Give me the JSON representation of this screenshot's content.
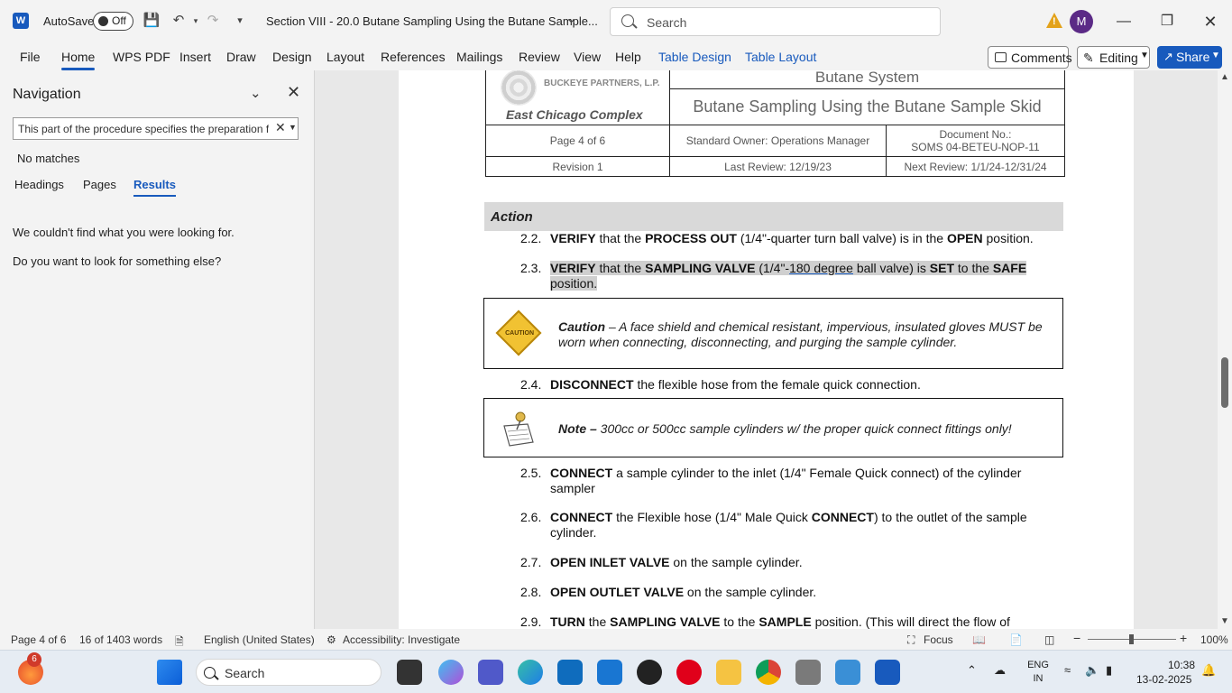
{
  "titlebar": {
    "autosave_label": "AutoSave",
    "autosave_state": "Off",
    "doc_title": "Section VIII - 20.0 Butane Sampling Using the Butane Sample...",
    "search_placeholder": "Search",
    "avatar_initial": "M"
  },
  "ribbon": {
    "tabs": [
      "File",
      "Home",
      "WPS PDF",
      "Insert",
      "Draw",
      "Design",
      "Layout",
      "References",
      "Mailings",
      "Review",
      "View",
      "Help",
      "Table Design",
      "Table Layout"
    ],
    "comments_label": "Comments",
    "editing_label": "Editing",
    "share_label": "Share"
  },
  "nav": {
    "title": "Navigation",
    "search_value": "This part of the procedure specifies the preparation f",
    "no_matches": "No matches",
    "tabs": [
      "Headings",
      "Pages",
      "Results"
    ],
    "message1": "We couldn't find what you were looking for.",
    "message2": "Do you want to look for something else?"
  },
  "doc": {
    "header": {
      "company": "BUCKEYE PARTNERS, L.P.",
      "site": "East Chicago Complex",
      "system": "Butane System",
      "procedure": "Butane Sampling Using the Butane Sample Skid",
      "page": "Page 4 of 6",
      "owner": "Standard Owner: Operations Manager",
      "docno_label": "Document No.:",
      "docno": "SOMS 04-BETEU-NOP-11",
      "revision": "Revision 1",
      "last_review": "Last Review: 12/19/23",
      "next_review": "Next Review: 1/1/24-12/31/24"
    },
    "action_label": "Action",
    "steps": {
      "s22": {
        "num": "2.2.",
        "b1": "VERIFY",
        "t1": " that the ",
        "b2": "PROCESS OUT",
        "t2": " (1/4\"-quarter turn ball valve) is in the ",
        "b3": "OPEN",
        "t3": " position."
      },
      "s23": {
        "num": "2.3.",
        "b1": "VERIFY",
        "t1": " that the ",
        "b2": "SAMPLING VALVE",
        "t2": " (1/4\"-",
        "u1": "180 degree",
        "t3": " ball valve) is ",
        "b3": "SET",
        "t4": " to the ",
        "b4": "SAFE",
        "t5": " position."
      },
      "caution_sign": "CAUTION",
      "caution_bold": "Caution",
      "caution_text": " – A face shield and chemical resistant, impervious, insulated gloves MUST be worn when connecting, disconnecting, and purging the sample cylinder.",
      "s24": {
        "num": "2.4.",
        "b1": "DISCONNECT",
        "t1": " the flexible hose from the female quick connection."
      },
      "note_bold": "Note –",
      "note_text": " 300cc or 500cc sample cylinders w/ the proper quick connect fittings only!",
      "s25": {
        "num": "2.5.",
        "b1": "CONNECT",
        "t1": " a sample cylinder to the inlet (1/4\" Female Quick connect) of the cylinder sampler"
      },
      "s26": {
        "num": "2.6.",
        "b1": "CONNECT",
        "t1": " the Flexible hose (1/4\" Male Quick ",
        "b2": "CONNECT",
        "t2": ") to the outlet of the sample cylinder."
      },
      "s27": {
        "num": "2.7.",
        "b1": "OPEN INLET VALVE",
        "t1": " on the sample cylinder."
      },
      "s28": {
        "num": "2.8.",
        "b1": "OPEN OUTLET VALVE",
        "t1": " on the sample cylinder."
      },
      "s29": {
        "num": "2.9.",
        "b1": "TURN",
        "t1": " the ",
        "b2": "SAMPLING VALVE",
        "t2": " to the ",
        "b3": "SAMPLE",
        "t3": " position. (This will direct the flow of"
      }
    }
  },
  "status": {
    "page": "Page 4 of 6",
    "words": "16 of 1403 words",
    "language": "English (United States)",
    "accessibility": "Accessibility: Investigate",
    "focus": "Focus",
    "zoom": "100%"
  },
  "taskbar": {
    "badge": "6",
    "search": "Search",
    "lang1": "ENG",
    "lang2": "IN",
    "time": "10:38",
    "date": "13-02-2025"
  }
}
